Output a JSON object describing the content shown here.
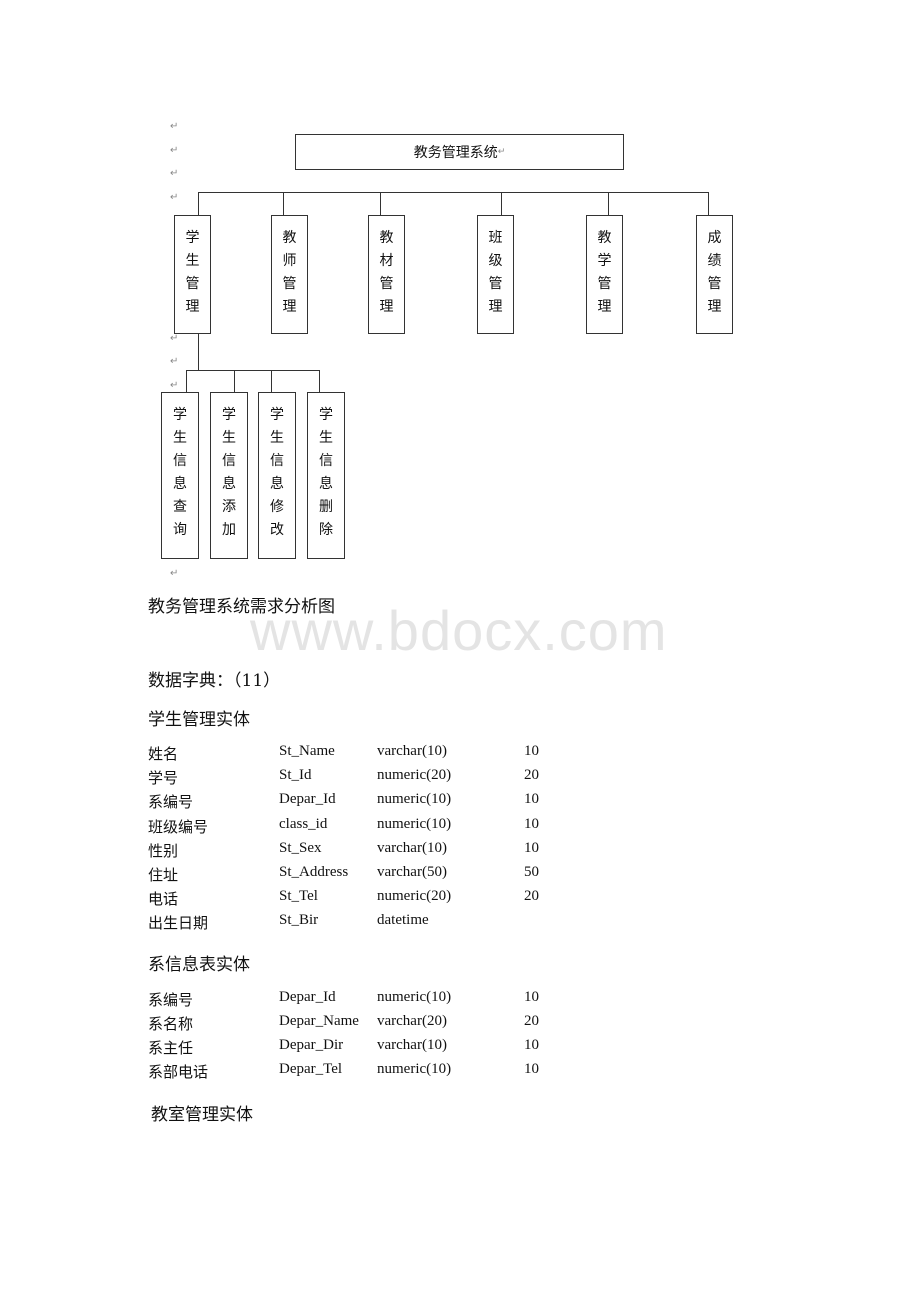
{
  "diagram": {
    "root": "教务管理系统",
    "level1": [
      {
        "label": "学生管理",
        "chars": [
          "学",
          "生",
          "管",
          "理"
        ]
      },
      {
        "label": "教师管理",
        "chars": [
          "教",
          "师",
          "管",
          "理"
        ]
      },
      {
        "label": "教材管理",
        "chars": [
          "教",
          "材",
          "管",
          "理"
        ]
      },
      {
        "label": "班级管理",
        "chars": [
          "班",
          "级",
          "管",
          "理"
        ]
      },
      {
        "label": "教学管理",
        "chars": [
          "教",
          "学",
          "管",
          "理"
        ]
      },
      {
        "label": "成绩管理",
        "chars": [
          "成",
          "绩",
          "管",
          "理"
        ]
      }
    ],
    "level2": [
      {
        "label": "学生信息查询",
        "chars": [
          "学",
          "生",
          "信",
          "息",
          "查",
          "询"
        ]
      },
      {
        "label": "学生信息添加",
        "chars": [
          "学",
          "生",
          "信",
          "息",
          "添",
          "加"
        ]
      },
      {
        "label": "学生信息修改",
        "chars": [
          "学",
          "生",
          "信",
          "息",
          "修",
          "改"
        ]
      },
      {
        "label": "学生信息删除",
        "chars": [
          "学",
          "生",
          "信",
          "息",
          "删",
          "除"
        ]
      }
    ],
    "paragraph_mark": "↵"
  },
  "caption": "教务管理系统需求分析图",
  "watermark": "www.bdocx.com",
  "data_dictionary_heading": "数据字典：（11）",
  "sections": [
    {
      "title": "学生管理实体",
      "rows": [
        [
          "姓名",
          "St_Name",
          "varchar(10)",
          "10"
        ],
        [
          "学号",
          "St_Id",
          "numeric(20)",
          "20"
        ],
        [
          "系编号",
          "Depar_Id",
          "numeric(10)",
          "10"
        ],
        [
          "班级编号",
          "class_id",
          "numeric(10)",
          "10"
        ],
        [
          "性别",
          "St_Sex",
          "varchar(10)",
          "10"
        ],
        [
          "住址",
          "St_Address",
          "varchar(50)",
          "50"
        ],
        [
          "电话",
          "St_Tel",
          "numeric(20)",
          "20"
        ],
        [
          "出生日期",
          "St_Bir",
          "datetime",
          ""
        ]
      ]
    },
    {
      "title": "系信息表实体",
      "rows": [
        [
          "系编号",
          "Depar_Id",
          "numeric(10)",
          "10"
        ],
        [
          "系名称",
          "Depar_Name",
          "varchar(20)",
          "20"
        ],
        [
          "系主任",
          "Depar_Dir",
          "varchar(10)",
          "10"
        ],
        [
          "系部电话",
          "Depar_Tel",
          "numeric(10)",
          "10"
        ]
      ]
    },
    {
      "title": "教室管理实体",
      "rows": []
    }
  ]
}
